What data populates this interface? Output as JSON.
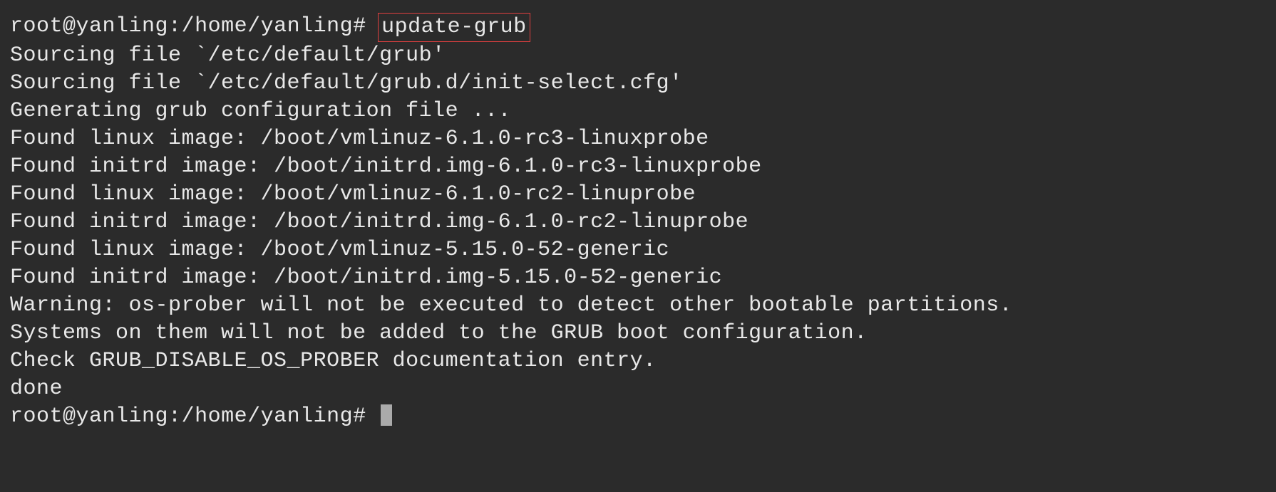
{
  "prompt1": {
    "user_host": "root@yanling",
    "separator": ":",
    "path": "/home/yanling",
    "sigil": "#",
    "command": "update-grub"
  },
  "output_lines": [
    "Sourcing file `/etc/default/grub'",
    "Sourcing file `/etc/default/grub.d/init-select.cfg'",
    "Generating grub configuration file ...",
    "Found linux image: /boot/vmlinuz-6.1.0-rc3-linuxprobe",
    "Found initrd image: /boot/initrd.img-6.1.0-rc3-linuxprobe",
    "Found linux image: /boot/vmlinuz-6.1.0-rc2-linuprobe",
    "Found initrd image: /boot/initrd.img-6.1.0-rc2-linuprobe",
    "Found linux image: /boot/vmlinuz-5.15.0-52-generic",
    "Found initrd image: /boot/initrd.img-5.15.0-52-generic",
    "Warning: os-prober will not be executed to detect other bootable partitions.",
    "Systems on them will not be added to the GRUB boot configuration.",
    "Check GRUB_DISABLE_OS_PROBER documentation entry.",
    "done"
  ],
  "prompt2": {
    "user_host": "root@yanling",
    "separator": ":",
    "path": "/home/yanling",
    "sigil": "#"
  }
}
